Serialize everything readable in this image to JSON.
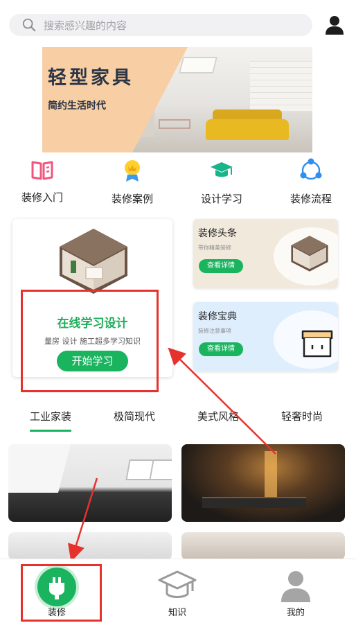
{
  "search": {
    "placeholder": "搜索感兴趣的内容"
  },
  "banner": {
    "title": "轻型家具",
    "subtitle": "简约生活时代"
  },
  "categories": [
    {
      "label": "装修入门",
      "icon": "book-icon"
    },
    {
      "label": "装修案例",
      "icon": "medal-icon"
    },
    {
      "label": "设计学习",
      "icon": "graduation-cap-icon"
    },
    {
      "label": "装修流程",
      "icon": "process-cycle-icon"
    }
  ],
  "featured": {
    "title": "在线学习设计",
    "subtitle": "量房 设计 施工超多学习知识",
    "button": "开始学习"
  },
  "cards": [
    {
      "title": "装修头条",
      "desc": "带你精美装修",
      "button": "查看详情",
      "bg": "#f1e9dc"
    },
    {
      "title": "装修宝典",
      "desc": "装修注意事项",
      "button": "查看详情",
      "bg": "#dfeefd"
    }
  ],
  "tabs": [
    "工业家装",
    "极简现代",
    "美式风格",
    "轻奢时尚"
  ],
  "active_tab": "工业家装",
  "nav": [
    {
      "label": "装修",
      "icon": "plug-icon",
      "active": true
    },
    {
      "label": "知识",
      "icon": "graduation-cap-icon",
      "active": false
    },
    {
      "label": "我的",
      "icon": "user-icon",
      "active": false
    }
  ],
  "colors": {
    "accent": "#1ab45f",
    "annotation": "#e5322d",
    "featured_title": "#1fae5b"
  }
}
